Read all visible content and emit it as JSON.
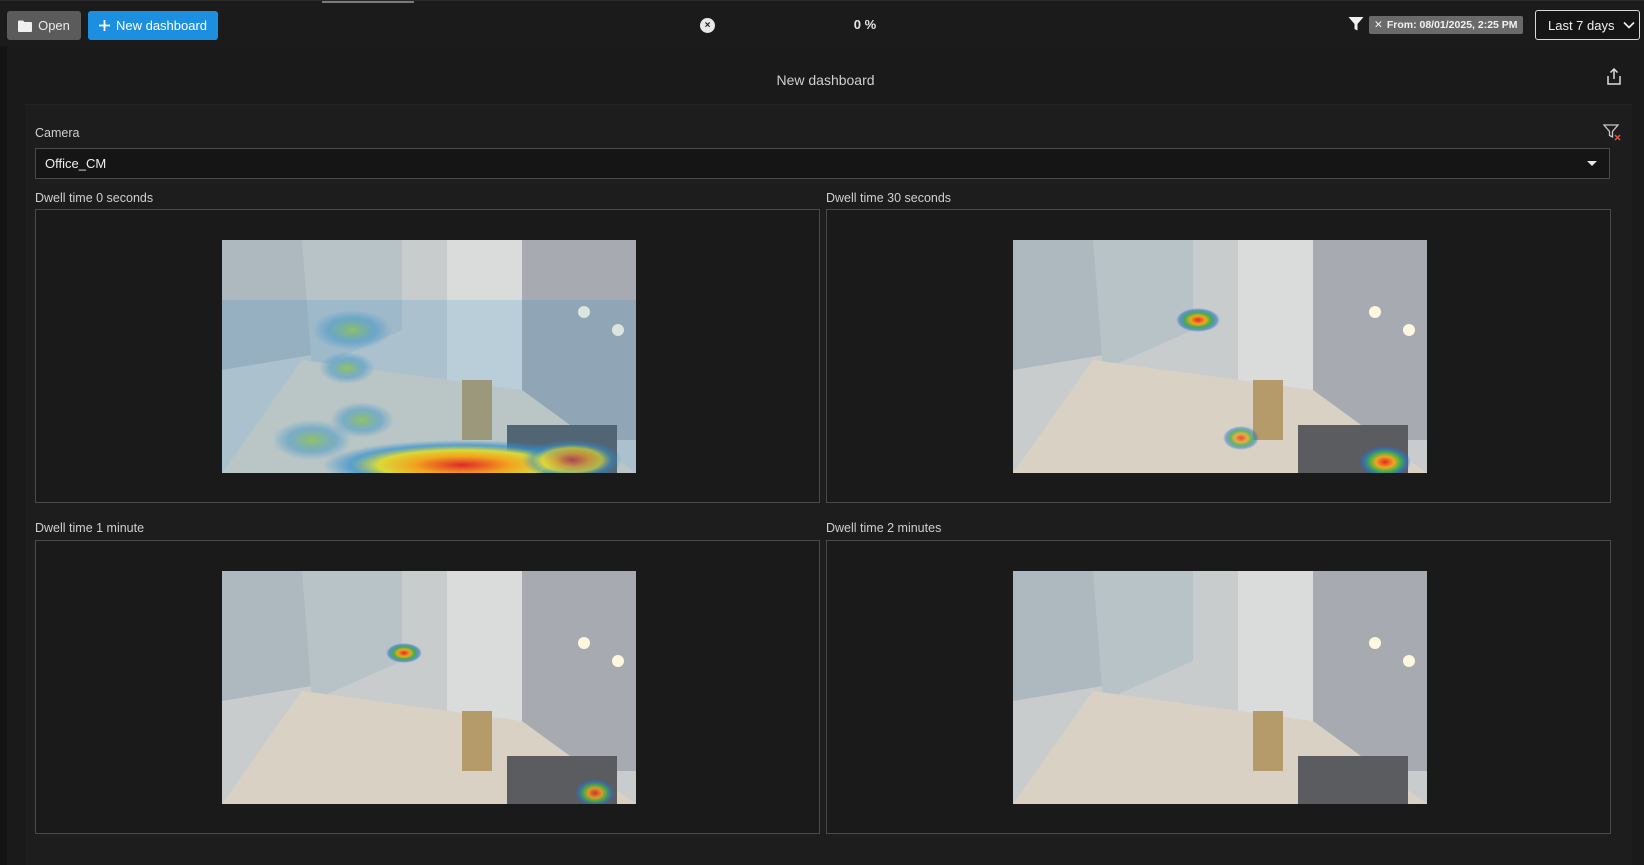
{
  "toolbar": {
    "open_label": "Open",
    "new_dashboard_label": "New dashboard",
    "progress": "0 %",
    "filter_chip": "From: 08/01/2025, 2:25 PM",
    "time_range": "Last 7 days"
  },
  "dashboard": {
    "title": "New dashboard"
  },
  "filters": {
    "camera_label": "Camera",
    "camera_value": "Office_CM"
  },
  "tiles": [
    {
      "label": "Dwell time 0 seconds"
    },
    {
      "label": "Dwell time 30 seconds"
    },
    {
      "label": "Dwell time 1 minute"
    },
    {
      "label": "Dwell time 2 minutes"
    }
  ],
  "colors": {
    "accent": "#1d8fe0",
    "background": "#141414",
    "panel": "#1d1d1d"
  }
}
